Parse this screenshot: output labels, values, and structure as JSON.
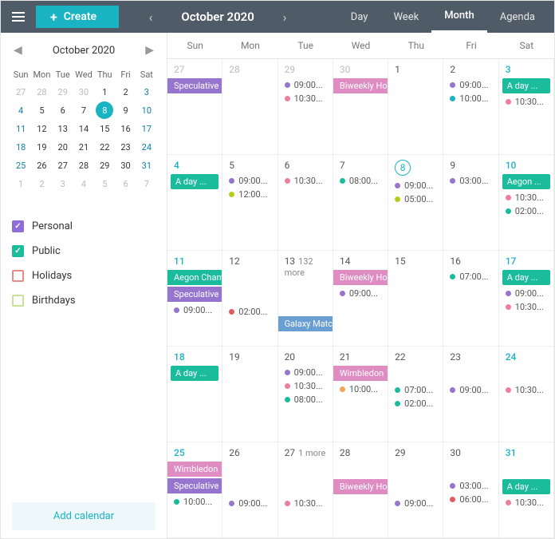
{
  "topbar": {
    "create": "Create",
    "month_label": "October 2020",
    "views": [
      "Day",
      "Week",
      "Month",
      "Agenda"
    ],
    "active_view": "Month"
  },
  "mini": {
    "title": "October 2020",
    "dow": [
      "Sun",
      "Mon",
      "Tue",
      "Wed",
      "Thu",
      "Fri",
      "Sat"
    ],
    "days": [
      {
        "n": 27,
        "other": true
      },
      {
        "n": 28,
        "other": true
      },
      {
        "n": 29,
        "other": true
      },
      {
        "n": 30,
        "other": true
      },
      {
        "n": 1
      },
      {
        "n": 2
      },
      {
        "n": 3,
        "weekend": true
      },
      {
        "n": 4,
        "weekend": true
      },
      {
        "n": 5
      },
      {
        "n": 6
      },
      {
        "n": 7
      },
      {
        "n": 8,
        "today": true
      },
      {
        "n": 9
      },
      {
        "n": 10,
        "weekend": true
      },
      {
        "n": 11,
        "weekend": true
      },
      {
        "n": 12
      },
      {
        "n": 13
      },
      {
        "n": 14
      },
      {
        "n": 15
      },
      {
        "n": 16
      },
      {
        "n": 17,
        "weekend": true
      },
      {
        "n": 18,
        "weekend": true
      },
      {
        "n": 19
      },
      {
        "n": 20
      },
      {
        "n": 21
      },
      {
        "n": 22
      },
      {
        "n": 23
      },
      {
        "n": 24,
        "weekend": true
      },
      {
        "n": 25,
        "weekend": true
      },
      {
        "n": 26
      },
      {
        "n": 27
      },
      {
        "n": 28
      },
      {
        "n": 29
      },
      {
        "n": 30
      },
      {
        "n": 31,
        "weekend": true
      },
      {
        "n": 1,
        "other": true
      },
      {
        "n": 2,
        "other": true
      },
      {
        "n": 3,
        "other": true
      },
      {
        "n": 4,
        "other": true
      },
      {
        "n": 5,
        "other": true
      },
      {
        "n": 6,
        "other": true
      },
      {
        "n": 7,
        "other": true
      }
    ]
  },
  "calendars": [
    {
      "name": "Personal",
      "color": "#8e6dd9",
      "checked": true
    },
    {
      "name": "Public",
      "color": "#1bbc9b",
      "checked": true
    },
    {
      "name": "Holidays",
      "color": "#e98b85",
      "checked": false
    },
    {
      "name": "Birthdays",
      "color": "#c8e29a",
      "checked": false
    }
  ],
  "add_calendar": "Add calendar",
  "dow_main": [
    "Sun",
    "Mon",
    "Tue",
    "Wed",
    "Thu",
    "Fri",
    "Sat"
  ],
  "colors": {
    "purple": "#9575cd",
    "pink": "#df8cc3",
    "teal": "#1bbc9b",
    "blue": "#6a9fd4",
    "orange": "#f1a65b",
    "lime": "#b5cc18",
    "tealdark": "#1ab3c4",
    "dpink": "#ec7f9a",
    "red": "#e15b60"
  },
  "cells": [
    [
      {
        "d": 27,
        "o": true
      },
      {
        "d": 28,
        "o": true
      },
      {
        "d": 29,
        "o": true
      },
      {
        "d": 30,
        "o": true
      },
      {
        "d": 1
      },
      {
        "d": 2
      },
      {
        "d": 3,
        "w": true
      }
    ],
    [
      {
        "d": 4,
        "w": true
      },
      {
        "d": 5
      },
      {
        "d": 6
      },
      {
        "d": 7
      },
      {
        "d": 8,
        "t": true
      },
      {
        "d": 9
      },
      {
        "d": 10,
        "w": true
      }
    ],
    [
      {
        "d": 11,
        "w": true
      },
      {
        "d": 12
      },
      {
        "d": 13,
        "more": "132 more"
      },
      {
        "d": 14
      },
      {
        "d": 15
      },
      {
        "d": 16
      },
      {
        "d": 17,
        "w": true
      }
    ],
    [
      {
        "d": 18,
        "w": true
      },
      {
        "d": 19
      },
      {
        "d": 20
      },
      {
        "d": 21
      },
      {
        "d": 22
      },
      {
        "d": 23
      },
      {
        "d": 24,
        "w": true
      }
    ],
    [
      {
        "d": 25,
        "w": true
      },
      {
        "d": 26
      },
      {
        "d": 27,
        "more": "1 more"
      },
      {
        "d": 28
      },
      {
        "d": 29
      },
      {
        "d": 30
      },
      {
        "d": 31,
        "w": true
      }
    ]
  ],
  "labels": {
    "sfdc": "Speculative Fiction Discussion Club",
    "bhb": "Biweekly Horror Boo...",
    "aday": "A day ...",
    "aegon": "Aegon Championship",
    "aegon2": "Aegon ...",
    "galaxy": "Galaxy Match",
    "wimbledon": "Wimbledon",
    "t0900": "09:00...",
    "t1000": "10:00...",
    "t1030": "10:30...",
    "t1200": "12:00...",
    "t0800": "08:00...",
    "t0500": "05:00...",
    "t0300": "03:00...",
    "t0200": "02:00...",
    "t0700": "07:00...",
    "t0600": "06:00..."
  }
}
